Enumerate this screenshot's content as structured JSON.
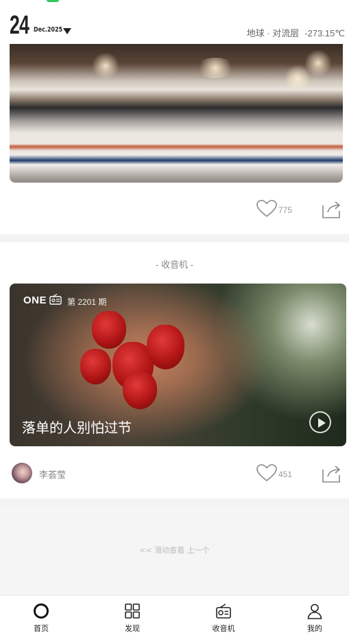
{
  "header": {
    "day": "24",
    "month": "Dec.2025",
    "location": "地球 · 对流层",
    "temperature": "-273.15℃"
  },
  "photo_post": {
    "like_count": "775"
  },
  "radio_section": {
    "section_title": "- 收音机 -",
    "logo": "ONE",
    "issue": "第 2201 期",
    "title": "落单的人别怕过节",
    "author": "李荟莹",
    "like_count": "451"
  },
  "swipe_hint": "<< 滑动查看 上一个",
  "tabbar": {
    "items": [
      {
        "label": "首页",
        "icon": "home-circle-icon",
        "active": true
      },
      {
        "label": "发现",
        "icon": "grid-icon"
      },
      {
        "label": "收音机",
        "icon": "radio-icon"
      },
      {
        "label": "我的",
        "icon": "user-icon"
      }
    ]
  },
  "colors": {
    "accent_battery": "#35c759",
    "text_dark": "#222222",
    "text_muted": "#888888",
    "separator": "#f3f3f3"
  }
}
